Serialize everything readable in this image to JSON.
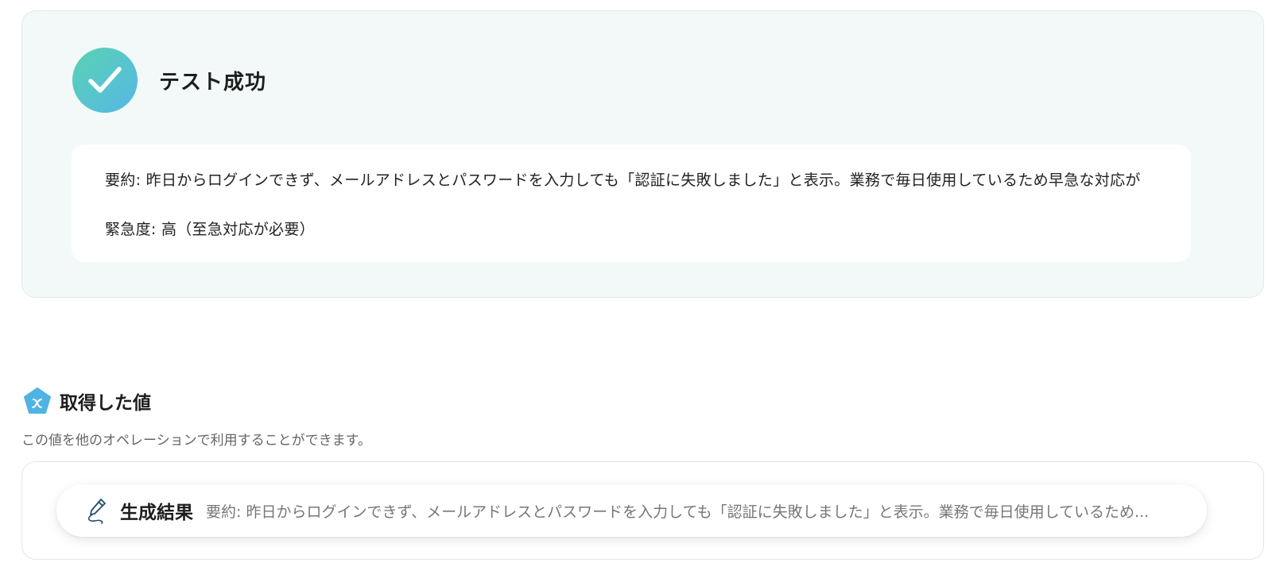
{
  "test_result": {
    "status_title": "テスト成功",
    "output_lines": [
      "要約: 昨日からログインできず、メールアドレスとパスワードを入力しても「認証に失敗しました」と表示。業務で毎日使用しているため早急な対応が",
      "緊急度: 高（至急対応が必要）"
    ]
  },
  "obtained_values": {
    "title": "取得した値",
    "description": "この値を他のオペレーションで利用することができます。",
    "items": [
      {
        "label": "生成結果",
        "value": "要約: 昨日からログインできず、メールアドレスとパスワードを入力しても「認証に失敗しました」と表示。業務で毎日使用しているため..."
      }
    ]
  },
  "icons": {
    "success": "check-circle-icon",
    "values": "variable-pentagon-icon",
    "item": "pen-icon"
  },
  "colors": {
    "success_gradient_start": "#5ad3b2",
    "success_gradient_end": "#56b7e6",
    "variable_icon": "#4fb3e4",
    "panel_bg": "#f3f9f9"
  }
}
